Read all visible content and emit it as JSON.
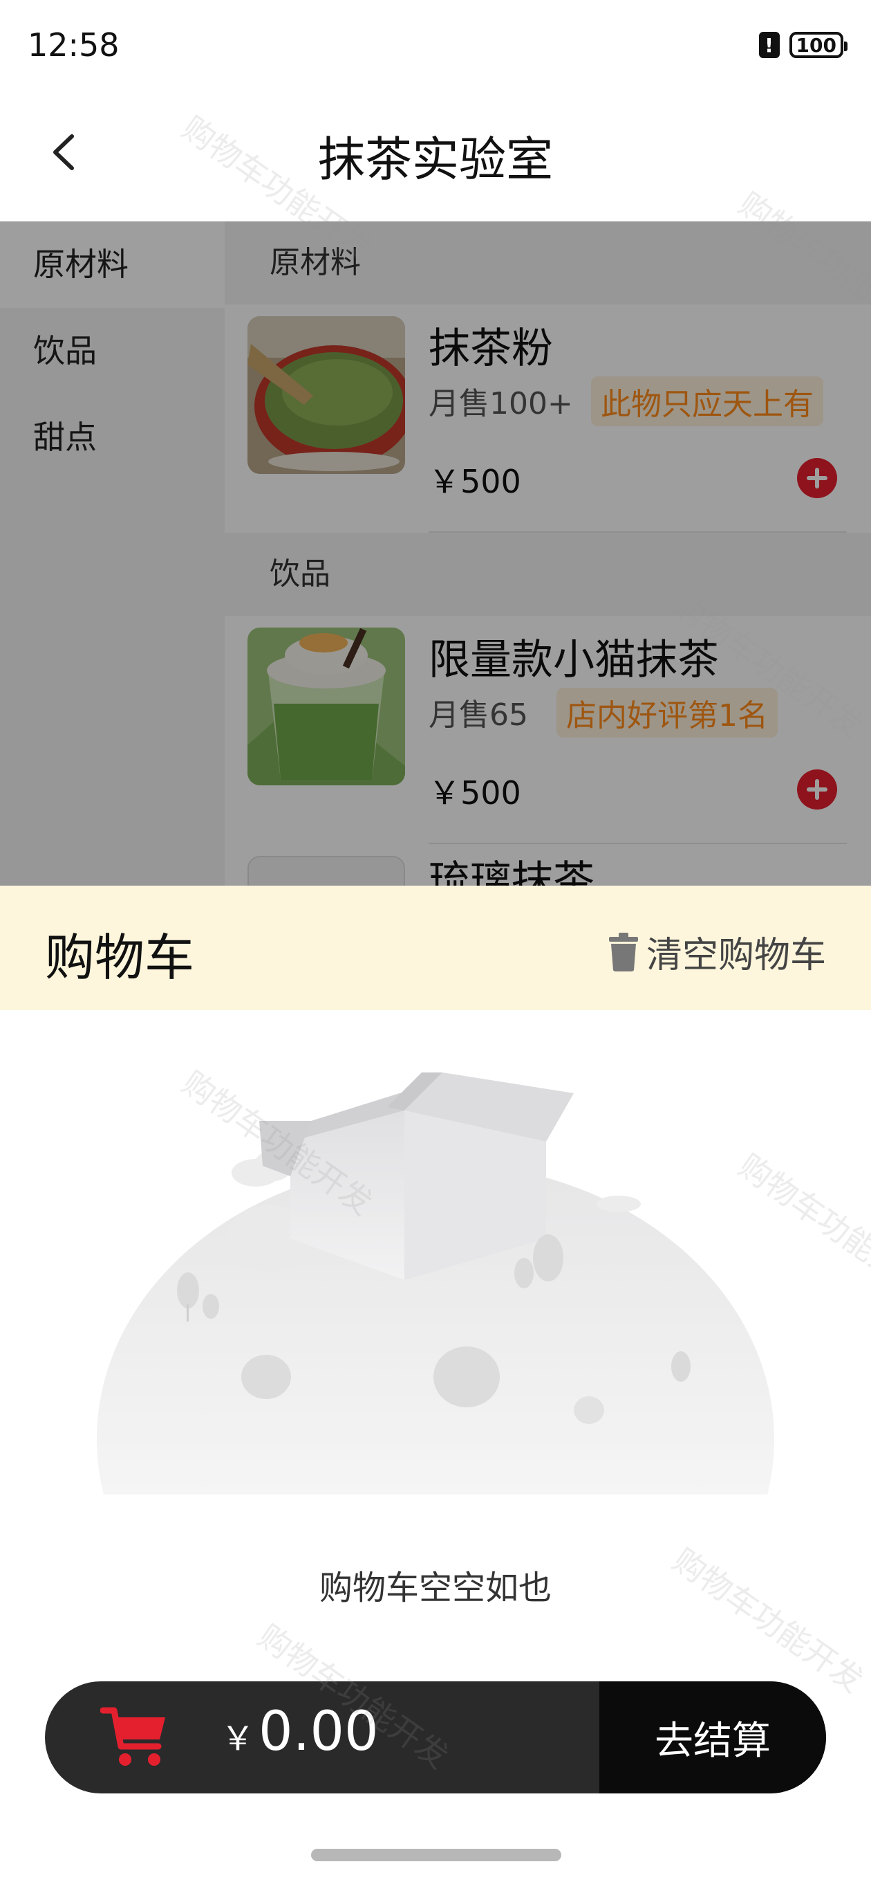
{
  "status_bar": {
    "time": "12:58",
    "alert_glyph": "!",
    "battery": "100"
  },
  "header": {
    "title": "抹茶实验室"
  },
  "categories": [
    {
      "label": "原材料",
      "active": true
    },
    {
      "label": "饮品",
      "active": false
    },
    {
      "label": "甜点",
      "active": false
    }
  ],
  "sections": [
    {
      "title": "原材料",
      "products": [
        {
          "name": "抹茶粉",
          "sales": "月售100+",
          "tag": "此物只应天上有",
          "price": "￥500"
        }
      ]
    },
    {
      "title": "饮品",
      "products": [
        {
          "name": "限量款小猫抹茶",
          "sales": "月售65",
          "tag": "店内好评第1名",
          "price": "￥500"
        },
        {
          "name": "琉璃抹茶"
        }
      ]
    }
  ],
  "cart": {
    "title": "购物车",
    "clear_label": "清空购物车",
    "empty_text": "购物车空空如也",
    "currency": "￥",
    "total": "0.00",
    "checkout_label": "去结算"
  },
  "watermark": {
    "text": "购物车功能开发"
  },
  "colors": {
    "accent_red": "#e5202e",
    "tag_orange": "#ff8c1a",
    "cart_header_bg": "#fdf6dc",
    "checkout_bar_bg": "#2a2a2b"
  },
  "icons": [
    "back-chevron-icon",
    "trash-icon",
    "shopping-cart-icon",
    "plus-circle-icon",
    "empty-box-illustration"
  ]
}
